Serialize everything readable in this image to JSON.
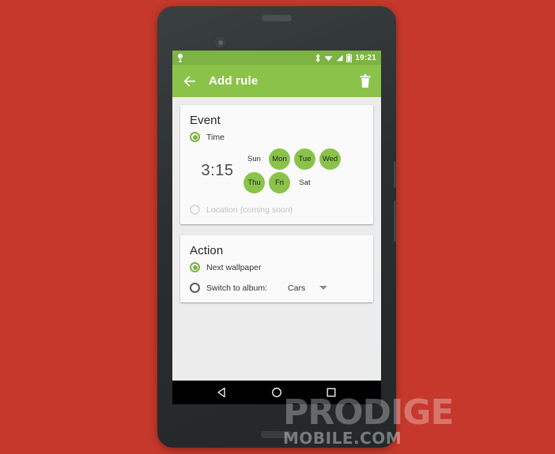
{
  "page": {
    "background_color": "#c6382c",
    "device": "android-phone-mockup"
  },
  "status_bar": {
    "notification_icon": "location-pin-icon",
    "bluetooth_icon": "bluetooth-icon",
    "wifi_icon": "wifi-icon",
    "signal_icon": "cellular-signal-icon",
    "battery_icon": "battery-icon",
    "time": "19:21",
    "background_color": "#7cb342"
  },
  "app_bar": {
    "back_icon": "back-arrow-icon",
    "title": "Add rule",
    "delete_icon": "trash-icon",
    "background_color": "#8bc34a"
  },
  "event_card": {
    "title": "Event",
    "time_option": {
      "label": "Time",
      "selected": true
    },
    "time_value": "3:15",
    "days": [
      {
        "label": "Sun",
        "selected": false
      },
      {
        "label": "Mon",
        "selected": true
      },
      {
        "label": "Tue",
        "selected": true
      },
      {
        "label": "Wed",
        "selected": true
      },
      {
        "label": "Thu",
        "selected": true
      },
      {
        "label": "Fri",
        "selected": true
      },
      {
        "label": "Sat",
        "selected": false
      }
    ],
    "location_option": {
      "label": "Location (coming soon)",
      "selected": false,
      "disabled": true
    }
  },
  "action_card": {
    "title": "Action",
    "next_wallpaper_option": {
      "label": "Next wallpaper",
      "selected": true
    },
    "switch_album_option": {
      "label": "Switch to album:",
      "selected": false
    },
    "album_select": {
      "value": "Cars",
      "caret_icon": "chevron-down-icon"
    }
  },
  "nav_bar": {
    "back_icon": "nav-back-triangle-icon",
    "home_icon": "nav-home-circle-icon",
    "recents_icon": "nav-recents-square-icon"
  },
  "watermark": {
    "line1": "PRODIGE",
    "line2": "MOBILE.COM"
  },
  "accent": {
    "green_dark": "#7cb342",
    "green_light": "#8bc34a",
    "card_background": "#fafafa",
    "screen_background": "#ececec"
  }
}
